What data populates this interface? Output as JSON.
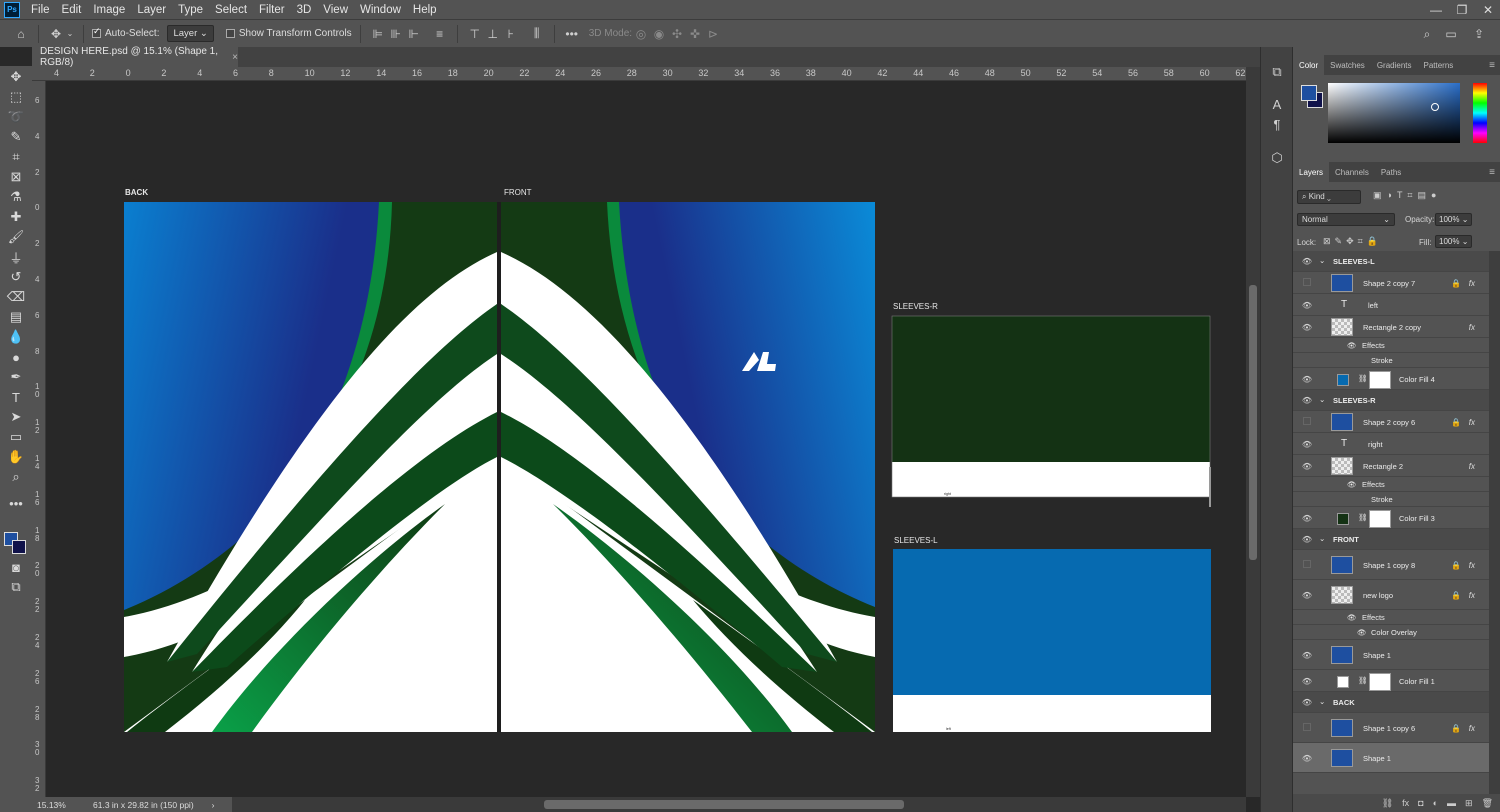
{
  "app": {
    "logo": "Ps",
    "menus": [
      "File",
      "Edit",
      "Image",
      "Layer",
      "Type",
      "Select",
      "Filter",
      "3D",
      "View",
      "Window",
      "Help"
    ]
  },
  "options": {
    "auto_select_label": "Auto-Select:",
    "auto_select_target": "Layer",
    "show_transform_label": "Show Transform Controls",
    "mode_3d_label": "3D Mode:"
  },
  "document": {
    "tab_title": "DESIGN HERE.psd @ 15.1% (Shape 1, RGB/8)",
    "close": "×"
  },
  "ruler": {
    "top": [
      "4",
      "2",
      "0",
      "2",
      "4",
      "6",
      "8",
      "10",
      "12",
      "14",
      "16",
      "18",
      "20",
      "22",
      "24",
      "26",
      "28",
      "30",
      "32",
      "34",
      "36",
      "38",
      "40",
      "42",
      "44",
      "46",
      "48",
      "50",
      "52",
      "54",
      "56",
      "58",
      "60",
      "62"
    ],
    "left": [
      "6",
      "4",
      "2",
      "0",
      "2",
      "4",
      "6",
      "8",
      "1\n0",
      "1\n2",
      "1\n4",
      "1\n6",
      "1\n8",
      "2\n0",
      "2\n2",
      "2\n4",
      "2\n6",
      "2\n8",
      "3\n0",
      "3\n2"
    ]
  },
  "artboards": {
    "back": "BACK",
    "front": "FRONT",
    "sleeves_r": "SLEEVES-R",
    "sleeves_l": "SLEEVES-L",
    "sleeve_r_small": "right",
    "sleeve_l_small": "left"
  },
  "status": {
    "zoom": "15.13%",
    "doc_info": "61.3 in x 29.82 in (150 ppi)"
  },
  "color_panel": {
    "tabs": [
      "Color",
      "Swatches",
      "Gradients",
      "Patterns"
    ],
    "active": "Color",
    "foreground": "#1e4fa0",
    "background": "#10124a"
  },
  "layers_panel": {
    "tabs": [
      "Layers",
      "Channels",
      "Paths"
    ],
    "active": "Layers",
    "filter_kind": "Kind",
    "blend_mode": "Normal",
    "opacity_label": "Opacity:",
    "opacity": "100%",
    "lock_label": "Lock:",
    "fill_label": "Fill:",
    "fill": "100%",
    "rows": [
      {
        "name": "SLEEVES-L",
        "type": "group"
      },
      {
        "name": "Shape 2 copy 7",
        "type": "shape",
        "fx": true,
        "lock": true
      },
      {
        "name": "left",
        "type": "text"
      },
      {
        "name": "Rectangle 2 copy",
        "type": "raster",
        "fx": true
      },
      {
        "name": "Effects",
        "type": "effects"
      },
      {
        "name": "Stroke",
        "type": "effect"
      },
      {
        "name": "Color Fill 4",
        "type": "fill"
      },
      {
        "name": "SLEEVES-R",
        "type": "group"
      },
      {
        "name": "Shape 2 copy 6",
        "type": "shape",
        "fx": true,
        "lock": true
      },
      {
        "name": "right",
        "type": "text"
      },
      {
        "name": "Rectangle 2",
        "type": "raster",
        "fx": true
      },
      {
        "name": "Effects",
        "type": "effects"
      },
      {
        "name": "Stroke",
        "type": "effect"
      },
      {
        "name": "Color Fill 3",
        "type": "fill"
      },
      {
        "name": "FRONT",
        "type": "group"
      },
      {
        "name": "Shape 1 copy 8",
        "type": "shape",
        "fx": true,
        "lock": true
      },
      {
        "name": "new logo",
        "type": "logo",
        "fx": true,
        "lock": true
      },
      {
        "name": "Effects",
        "type": "effects"
      },
      {
        "name": "Color Overlay",
        "type": "effect"
      },
      {
        "name": "Shape 1",
        "type": "shape"
      },
      {
        "name": "Color Fill 1",
        "type": "fill"
      },
      {
        "name": "BACK",
        "type": "group"
      },
      {
        "name": "Shape 1 copy 6",
        "type": "shape",
        "fx": true,
        "lock": true
      },
      {
        "name": "Shape 1",
        "type": "shape",
        "selected": true
      }
    ]
  },
  "colors": {
    "blue_dark": "#1a2f8a",
    "blue_light": "#0a8bd8",
    "green_dark": "#123a12",
    "green": "#0a8a3c",
    "sleeve_green": "#143214",
    "sleeve_blue": "#066ab0"
  }
}
